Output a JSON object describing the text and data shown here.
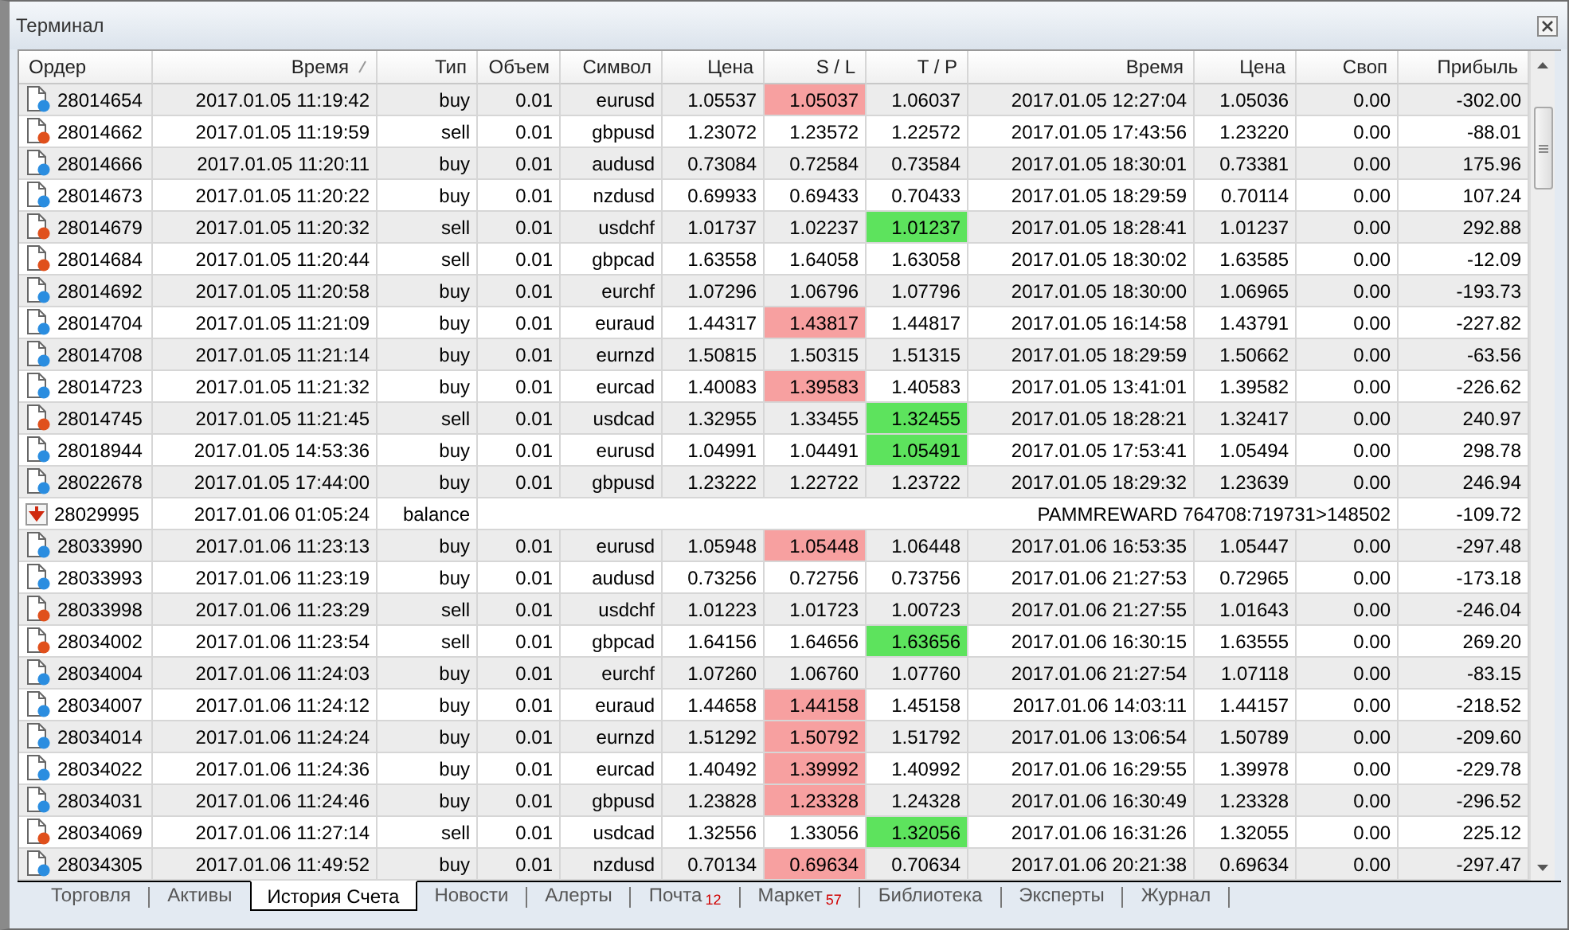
{
  "window": {
    "title": "Терминал"
  },
  "columns": [
    {
      "label": "Ордер",
      "sorted": false
    },
    {
      "label": "Время",
      "sorted": true
    },
    {
      "label": "Тип",
      "sorted": false
    },
    {
      "label": "Объем",
      "sorted": false
    },
    {
      "label": "Символ",
      "sorted": false
    },
    {
      "label": "Цена",
      "sorted": false
    },
    {
      "label": "S / L",
      "sorted": false
    },
    {
      "label": "T / P",
      "sorted": false
    },
    {
      "label": "Время",
      "sorted": false
    },
    {
      "label": "Цена",
      "sorted": false
    },
    {
      "label": "Своп",
      "sorted": false
    },
    {
      "label": "Прибыль",
      "sorted": false
    }
  ],
  "rows": [
    {
      "kind": "buy",
      "order": "28014654",
      "open_time": "2017.01.05 11:19:42",
      "type": "buy",
      "volume": "0.01",
      "symbol": "eurusd",
      "open_price": "1.05537",
      "sl": "1.05037",
      "sl_hit": true,
      "tp": "1.06037",
      "tp_hit": false,
      "close_time": "2017.01.05 12:27:04",
      "close_price": "1.05036",
      "swap": "0.00",
      "profit": "-302.00"
    },
    {
      "kind": "sell",
      "order": "28014662",
      "open_time": "2017.01.05 11:19:59",
      "type": "sell",
      "volume": "0.01",
      "symbol": "gbpusd",
      "open_price": "1.23072",
      "sl": "1.23572",
      "sl_hit": false,
      "tp": "1.22572",
      "tp_hit": false,
      "close_time": "2017.01.05 17:43:56",
      "close_price": "1.23220",
      "swap": "0.00",
      "profit": "-88.01"
    },
    {
      "kind": "buy",
      "order": "28014666",
      "open_time": "2017.01.05 11:20:11",
      "type": "buy",
      "volume": "0.01",
      "symbol": "audusd",
      "open_price": "0.73084",
      "sl": "0.72584",
      "sl_hit": false,
      "tp": "0.73584",
      "tp_hit": false,
      "close_time": "2017.01.05 18:30:01",
      "close_price": "0.73381",
      "swap": "0.00",
      "profit": "175.96"
    },
    {
      "kind": "buy",
      "order": "28014673",
      "open_time": "2017.01.05 11:20:22",
      "type": "buy",
      "volume": "0.01",
      "symbol": "nzdusd",
      "open_price": "0.69933",
      "sl": "0.69433",
      "sl_hit": false,
      "tp": "0.70433",
      "tp_hit": false,
      "close_time": "2017.01.05 18:29:59",
      "close_price": "0.70114",
      "swap": "0.00",
      "profit": "107.24"
    },
    {
      "kind": "sell",
      "order": "28014679",
      "open_time": "2017.01.05 11:20:32",
      "type": "sell",
      "volume": "0.01",
      "symbol": "usdchf",
      "open_price": "1.01737",
      "sl": "1.02237",
      "sl_hit": false,
      "tp": "1.01237",
      "tp_hit": true,
      "close_time": "2017.01.05 18:28:41",
      "close_price": "1.01237",
      "swap": "0.00",
      "profit": "292.88"
    },
    {
      "kind": "sell",
      "order": "28014684",
      "open_time": "2017.01.05 11:20:44",
      "type": "sell",
      "volume": "0.01",
      "symbol": "gbpcad",
      "open_price": "1.63558",
      "sl": "1.64058",
      "sl_hit": false,
      "tp": "1.63058",
      "tp_hit": false,
      "close_time": "2017.01.05 18:30:02",
      "close_price": "1.63585",
      "swap": "0.00",
      "profit": "-12.09"
    },
    {
      "kind": "buy",
      "order": "28014692",
      "open_time": "2017.01.05 11:20:58",
      "type": "buy",
      "volume": "0.01",
      "symbol": "eurchf",
      "open_price": "1.07296",
      "sl": "1.06796",
      "sl_hit": false,
      "tp": "1.07796",
      "tp_hit": false,
      "close_time": "2017.01.05 18:30:00",
      "close_price": "1.06965",
      "swap": "0.00",
      "profit": "-193.73"
    },
    {
      "kind": "buy",
      "order": "28014704",
      "open_time": "2017.01.05 11:21:09",
      "type": "buy",
      "volume": "0.01",
      "symbol": "euraud",
      "open_price": "1.44317",
      "sl": "1.43817",
      "sl_hit": true,
      "tp": "1.44817",
      "tp_hit": false,
      "close_time": "2017.01.05 16:14:58",
      "close_price": "1.43791",
      "swap": "0.00",
      "profit": "-227.82"
    },
    {
      "kind": "buy",
      "order": "28014708",
      "open_time": "2017.01.05 11:21:14",
      "type": "buy",
      "volume": "0.01",
      "symbol": "eurnzd",
      "open_price": "1.50815",
      "sl": "1.50315",
      "sl_hit": false,
      "tp": "1.51315",
      "tp_hit": false,
      "close_time": "2017.01.05 18:29:59",
      "close_price": "1.50662",
      "swap": "0.00",
      "profit": "-63.56"
    },
    {
      "kind": "buy",
      "order": "28014723",
      "open_time": "2017.01.05 11:21:32",
      "type": "buy",
      "volume": "0.01",
      "symbol": "eurcad",
      "open_price": "1.40083",
      "sl": "1.39583",
      "sl_hit": true,
      "tp": "1.40583",
      "tp_hit": false,
      "close_time": "2017.01.05 13:41:01",
      "close_price": "1.39582",
      "swap": "0.00",
      "profit": "-226.62"
    },
    {
      "kind": "sell",
      "order": "28014745",
      "open_time": "2017.01.05 11:21:45",
      "type": "sell",
      "volume": "0.01",
      "symbol": "usdcad",
      "open_price": "1.32955",
      "sl": "1.33455",
      "sl_hit": false,
      "tp": "1.32455",
      "tp_hit": true,
      "close_time": "2017.01.05 18:28:21",
      "close_price": "1.32417",
      "swap": "0.00",
      "profit": "240.97"
    },
    {
      "kind": "buy",
      "order": "28018944",
      "open_time": "2017.01.05 14:53:36",
      "type": "buy",
      "volume": "0.01",
      "symbol": "eurusd",
      "open_price": "1.04991",
      "sl": "1.04491",
      "sl_hit": false,
      "tp": "1.05491",
      "tp_hit": true,
      "close_time": "2017.01.05 17:53:41",
      "close_price": "1.05494",
      "swap": "0.00",
      "profit": "298.78"
    },
    {
      "kind": "buy",
      "order": "28022678",
      "open_time": "2017.01.05 17:44:00",
      "type": "buy",
      "volume": "0.01",
      "symbol": "gbpusd",
      "open_price": "1.23222",
      "sl": "1.22722",
      "sl_hit": false,
      "tp": "1.23722",
      "tp_hit": false,
      "close_time": "2017.01.05 18:29:32",
      "close_price": "1.23639",
      "swap": "0.00",
      "profit": "246.94"
    },
    {
      "kind": "balance",
      "order": "28029995",
      "open_time": "2017.01.06 01:05:24",
      "type": "balance",
      "comment": "PAMMREWARD 764708:719731>148502",
      "profit": "-109.72"
    },
    {
      "kind": "buy",
      "order": "28033990",
      "open_time": "2017.01.06 11:23:13",
      "type": "buy",
      "volume": "0.01",
      "symbol": "eurusd",
      "open_price": "1.05948",
      "sl": "1.05448",
      "sl_hit": true,
      "tp": "1.06448",
      "tp_hit": false,
      "close_time": "2017.01.06 16:53:35",
      "close_price": "1.05447",
      "swap": "0.00",
      "profit": "-297.48"
    },
    {
      "kind": "buy",
      "order": "28033993",
      "open_time": "2017.01.06 11:23:19",
      "type": "buy",
      "volume": "0.01",
      "symbol": "audusd",
      "open_price": "0.73256",
      "sl": "0.72756",
      "sl_hit": false,
      "tp": "0.73756",
      "tp_hit": false,
      "close_time": "2017.01.06 21:27:53",
      "close_price": "0.72965",
      "swap": "0.00",
      "profit": "-173.18"
    },
    {
      "kind": "sell",
      "order": "28033998",
      "open_time": "2017.01.06 11:23:29",
      "type": "sell",
      "volume": "0.01",
      "symbol": "usdchf",
      "open_price": "1.01223",
      "sl": "1.01723",
      "sl_hit": false,
      "tp": "1.00723",
      "tp_hit": false,
      "close_time": "2017.01.06 21:27:55",
      "close_price": "1.01643",
      "swap": "0.00",
      "profit": "-246.04"
    },
    {
      "kind": "sell",
      "order": "28034002",
      "open_time": "2017.01.06 11:23:54",
      "type": "sell",
      "volume": "0.01",
      "symbol": "gbpcad",
      "open_price": "1.64156",
      "sl": "1.64656",
      "sl_hit": false,
      "tp": "1.63656",
      "tp_hit": true,
      "close_time": "2017.01.06 16:30:15",
      "close_price": "1.63555",
      "swap": "0.00",
      "profit": "269.20"
    },
    {
      "kind": "buy",
      "order": "28034004",
      "open_time": "2017.01.06 11:24:03",
      "type": "buy",
      "volume": "0.01",
      "symbol": "eurchf",
      "open_price": "1.07260",
      "sl": "1.06760",
      "sl_hit": false,
      "tp": "1.07760",
      "tp_hit": false,
      "close_time": "2017.01.06 21:27:54",
      "close_price": "1.07118",
      "swap": "0.00",
      "profit": "-83.15"
    },
    {
      "kind": "buy",
      "order": "28034007",
      "open_time": "2017.01.06 11:24:12",
      "type": "buy",
      "volume": "0.01",
      "symbol": "euraud",
      "open_price": "1.44658",
      "sl": "1.44158",
      "sl_hit": true,
      "tp": "1.45158",
      "tp_hit": false,
      "close_time": "2017.01.06 14:03:11",
      "close_price": "1.44157",
      "swap": "0.00",
      "profit": "-218.52"
    },
    {
      "kind": "buy",
      "order": "28034014",
      "open_time": "2017.01.06 11:24:24",
      "type": "buy",
      "volume": "0.01",
      "symbol": "eurnzd",
      "open_price": "1.51292",
      "sl": "1.50792",
      "sl_hit": true,
      "tp": "1.51792",
      "tp_hit": false,
      "close_time": "2017.01.06 13:06:54",
      "close_price": "1.50789",
      "swap": "0.00",
      "profit": "-209.60"
    },
    {
      "kind": "buy",
      "order": "28034022",
      "open_time": "2017.01.06 11:24:36",
      "type": "buy",
      "volume": "0.01",
      "symbol": "eurcad",
      "open_price": "1.40492",
      "sl": "1.39992",
      "sl_hit": true,
      "tp": "1.40992",
      "tp_hit": false,
      "close_time": "2017.01.06 16:29:55",
      "close_price": "1.39978",
      "swap": "0.00",
      "profit": "-229.78"
    },
    {
      "kind": "buy",
      "order": "28034031",
      "open_time": "2017.01.06 11:24:46",
      "type": "buy",
      "volume": "0.01",
      "symbol": "gbpusd",
      "open_price": "1.23828",
      "sl": "1.23328",
      "sl_hit": true,
      "tp": "1.24328",
      "tp_hit": false,
      "close_time": "2017.01.06 16:30:49",
      "close_price": "1.23328",
      "swap": "0.00",
      "profit": "-296.52"
    },
    {
      "kind": "sell",
      "order": "28034069",
      "open_time": "2017.01.06 11:27:14",
      "type": "sell",
      "volume": "0.01",
      "symbol": "usdcad",
      "open_price": "1.32556",
      "sl": "1.33056",
      "sl_hit": false,
      "tp": "1.32056",
      "tp_hit": true,
      "close_time": "2017.01.06 16:31:26",
      "close_price": "1.32055",
      "swap": "0.00",
      "profit": "225.12"
    },
    {
      "kind": "buy",
      "order": "28034305",
      "open_time": "2017.01.06 11:49:52",
      "type": "buy",
      "volume": "0.01",
      "symbol": "nzdusd",
      "open_price": "0.70134",
      "sl": "0.69634",
      "sl_hit": true,
      "tp": "0.70634",
      "tp_hit": false,
      "close_time": "2017.01.06 20:21:38",
      "close_price": "0.69634",
      "swap": "0.00",
      "profit": "-297.47"
    }
  ],
  "tabs": [
    {
      "label": "Торговля",
      "selected": false
    },
    {
      "label": "Активы",
      "selected": false
    },
    {
      "label": "История Счета",
      "selected": true
    },
    {
      "label": "Новости",
      "selected": false
    },
    {
      "label": "Алерты",
      "selected": false
    },
    {
      "label": "Почта",
      "badge": "12",
      "selected": false
    },
    {
      "label": "Маркет",
      "badge": "57",
      "selected": false
    },
    {
      "label": "Библиотека",
      "selected": false
    },
    {
      "label": "Эксперты",
      "selected": false
    },
    {
      "label": "Журнал",
      "selected": false
    }
  ]
}
